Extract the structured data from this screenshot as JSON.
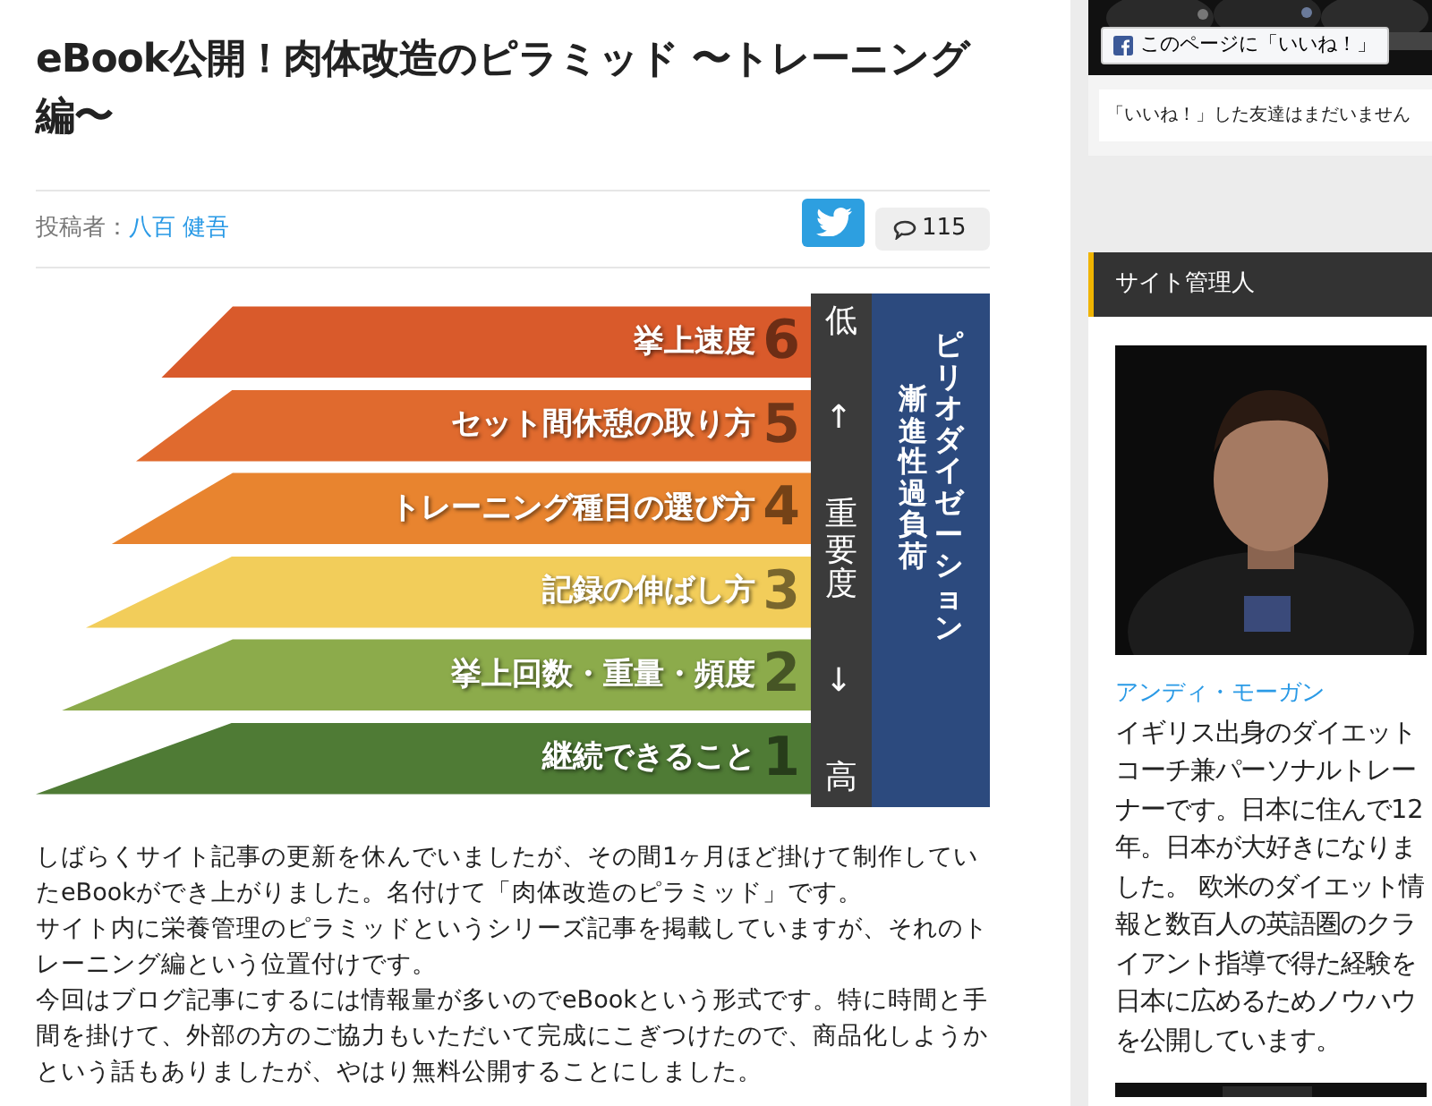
{
  "article": {
    "title": "eBook公開！肉体改造のピラミッド 〜トレーニング編〜",
    "meta": {
      "label": "投稿者：",
      "author": "八百 健吾",
      "comment_count": "115"
    },
    "infographic": {
      "levels": [
        {
          "label": "挙上速度",
          "number": "6",
          "color": "#d95a2b"
        },
        {
          "label": "セット間休憩の取り方",
          "number": "5",
          "color": "#e06a2e"
        },
        {
          "label": "トレーニング種目の選び方",
          "number": "4",
          "color": "#e8842f"
        },
        {
          "label": "記録の伸ばし方",
          "number": "3",
          "color": "#f2cd5a"
        },
        {
          "label": "挙上回数・重量・頻度",
          "number": "2",
          "color": "#8cab4b"
        },
        {
          "label": "継続できること",
          "number": "1",
          "color": "#4f7b35"
        }
      ],
      "importance": {
        "low": "低",
        "up_arrow": "↑",
        "label": "重要度",
        "down_arrow": "↓",
        "high": "高"
      },
      "concepts": [
        "漸進性過負荷",
        "ピリオダイゼーション"
      ]
    },
    "paragraphs": [
      "しばらくサイト記事の更新を休んでいましたが、その間1ヶ月ほど掛けて制作していたeBookができ上がりました。名付けて「肉体改造のピラミッド」です。",
      "サイト内に栄養管理のピラミッドというシリーズ記事を掲載していますが、それのトレーニング編という位置付けです。",
      "今回はブログ記事にするには情報量が多いのでeBookという形式です。特に時間と手間を掛けて、外部の方のご協力もいただいて完成にこぎつけたので、商品化しようかという話もありましたが、やはり無料公開することにしました。"
    ]
  },
  "sidebar": {
    "like_button": "このページに「いいね！」",
    "friends_note": "「いいね！」した友達はまだいません",
    "admin": {
      "heading": "サイト管理人",
      "name": "アンディ・モーガン",
      "bio": "イギリス出身のダイエットコーチ兼パーソナルトレーナーです。日本に住んで12年。日本が大好きになりました。 欧米のダイエット情報と数百人の英語圏のクライアント指導で得た経験を日本に広めるためノウハウを公開しています。"
    }
  }
}
